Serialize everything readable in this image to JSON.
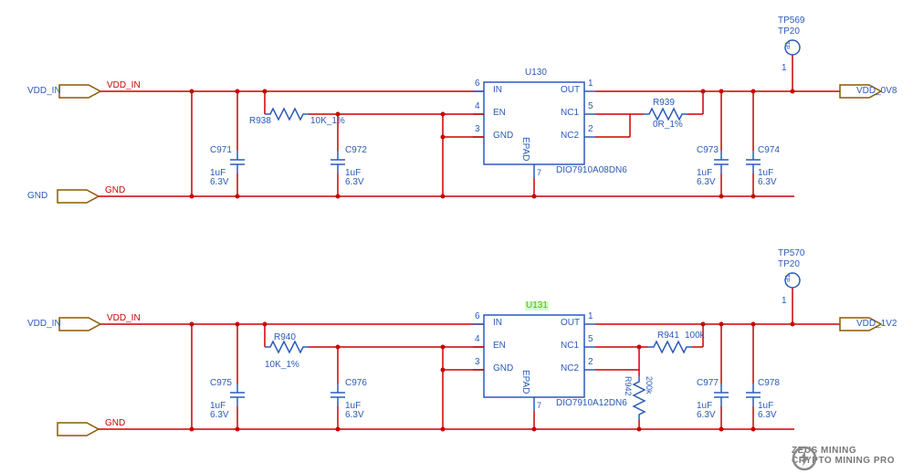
{
  "circuit1": {
    "input_net": "VDD_IN",
    "input_net_text": "VDD_IN",
    "output_net": "VDD_0V8",
    "gnd_net": "GND",
    "gnd_text": "GND",
    "ic": {
      "ref": "U130",
      "part": "DIO7910A08DN6",
      "pins": {
        "in": "IN",
        "en": "EN",
        "gnd": "GND",
        "epad": "EPAD",
        "out": "OUT",
        "nc1": "NC1",
        "nc2": "NC2",
        "pin6": "6",
        "pin4": "4",
        "pin3": "3",
        "pin7": "7",
        "pin1": "1",
        "pin5": "5",
        "pin2": "2"
      }
    },
    "r1": {
      "ref": "R938",
      "value": "10K_1%"
    },
    "r2": {
      "ref": "R939",
      "value": "0R_1%"
    },
    "c1": {
      "ref": "C971",
      "value": "1uF",
      "voltage": "6.3V"
    },
    "c2": {
      "ref": "C972",
      "value": "1uF",
      "voltage": "6.3V"
    },
    "c3": {
      "ref": "C973",
      "value": "1uF",
      "voltage": "6.3V"
    },
    "c4": {
      "ref": "C974",
      "value": "1uF",
      "voltage": "6.3V"
    },
    "tp": {
      "ref1": "TP569",
      "ref2": "TP20",
      "pin": "1",
      "glyph": "TP"
    }
  },
  "circuit2": {
    "input_net": "VDD_IN",
    "input_net_text": "VDD_IN",
    "output_net": "VDD_1V2",
    "gnd_net": "GND",
    "gnd_text": "GND",
    "ic": {
      "ref": "U131",
      "part": "DIO7910A12DN6",
      "pins": {
        "in": "IN",
        "en": "EN",
        "gnd": "GND",
        "epad": "EPAD",
        "out": "OUT",
        "nc1": "NC1",
        "nc2": "NC2",
        "pin6": "6",
        "pin4": "4",
        "pin3": "3",
        "pin7": "7",
        "pin1": "1",
        "pin5": "5",
        "pin2": "2"
      }
    },
    "r1": {
      "ref": "R940",
      "value": "10K_1%"
    },
    "r2": {
      "ref": "R941",
      "value": "100k"
    },
    "r3": {
      "ref": "R942",
      "value": "200k"
    },
    "c1": {
      "ref": "C975",
      "value": "1uF",
      "voltage": "6.3V"
    },
    "c2": {
      "ref": "C976",
      "value": "1uF",
      "voltage": "6.3V"
    },
    "c3": {
      "ref": "C977",
      "value": "1uF",
      "voltage": "6.3V"
    },
    "c4": {
      "ref": "C978",
      "value": "1uF",
      "voltage": "6.3V"
    },
    "tp": {
      "ref1": "TP570",
      "ref2": "TP20",
      "pin": "1",
      "glyph": "TP"
    }
  },
  "watermark": {
    "line1": "ZEUS MINING",
    "line2": "CRYPTO MINING PRO"
  }
}
